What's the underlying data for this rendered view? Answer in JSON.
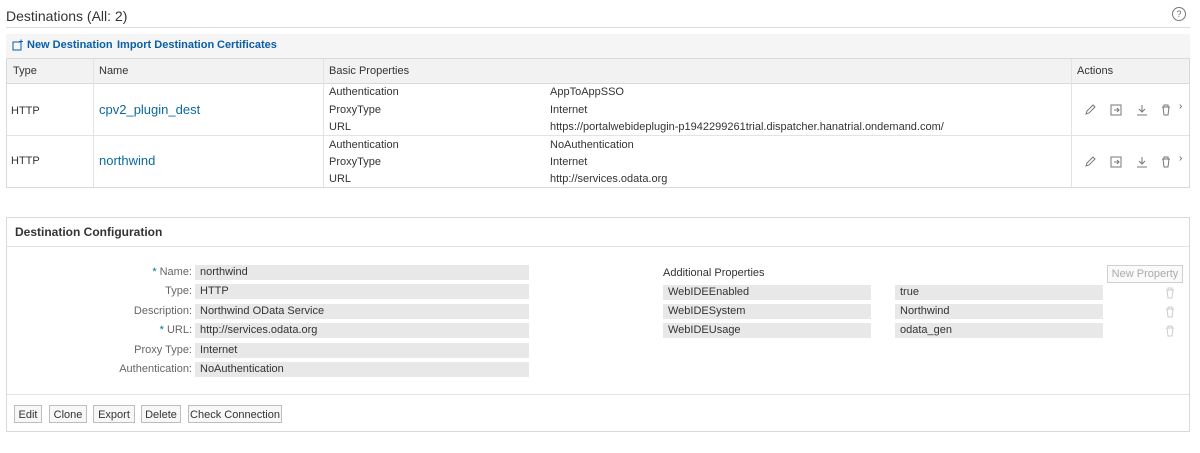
{
  "header": {
    "title": "Destinations (All: 2)",
    "help_glyph": "?"
  },
  "toolbar": {
    "new_destination": "New Destination",
    "import_destination": "Import Destination",
    "certificates": "Certificates"
  },
  "table": {
    "columns": [
      "Type",
      "Name",
      "Basic Properties",
      "Actions"
    ],
    "rows": [
      {
        "type": "HTTP",
        "name": "cpv2_plugin_dest",
        "props": [
          {
            "key": "Authentication",
            "value": "AppToAppSSO"
          },
          {
            "key": "ProxyType",
            "value": "Internet"
          },
          {
            "key": "URL",
            "value": "https://portalwebideplugin-p1942299261trial.dispatcher.hanatrial.ondemand.com/"
          }
        ]
      },
      {
        "type": "HTTP",
        "name": "northwind",
        "props": [
          {
            "key": "Authentication",
            "value": "NoAuthentication"
          },
          {
            "key": "ProxyType",
            "value": "Internet"
          },
          {
            "key": "URL",
            "value": "http://services.odata.org"
          }
        ]
      }
    ]
  },
  "config": {
    "title": "Destination Configuration",
    "fields": [
      {
        "label": "Name:",
        "value": "northwind",
        "required": true
      },
      {
        "label": "Type:",
        "value": "HTTP",
        "required": false
      },
      {
        "label": "Description:",
        "value": "Northwind OData Service",
        "required": false
      },
      {
        "label": "URL:",
        "value": "http://services.odata.org",
        "required": true
      },
      {
        "label": "Proxy Type:",
        "value": "Internet",
        "required": false
      },
      {
        "label": "Authentication:",
        "value": "NoAuthentication",
        "required": false
      }
    ],
    "required_marker": "*",
    "additional_title": "Additional Properties",
    "new_property": "New Property",
    "additional": [
      {
        "key": "WebIDEEnabled",
        "value": "true"
      },
      {
        "key": "WebIDESystem",
        "value": "Northwind"
      },
      {
        "key": "WebIDEUsage",
        "value": "odata_gen"
      }
    ],
    "buttons": {
      "edit": "Edit",
      "clone": "Clone",
      "export": "Export",
      "delete": "Delete",
      "check": "Check Connection"
    }
  },
  "colors": {
    "link": "#0a6aa1",
    "toolbar_link": "#0a5ea8"
  }
}
